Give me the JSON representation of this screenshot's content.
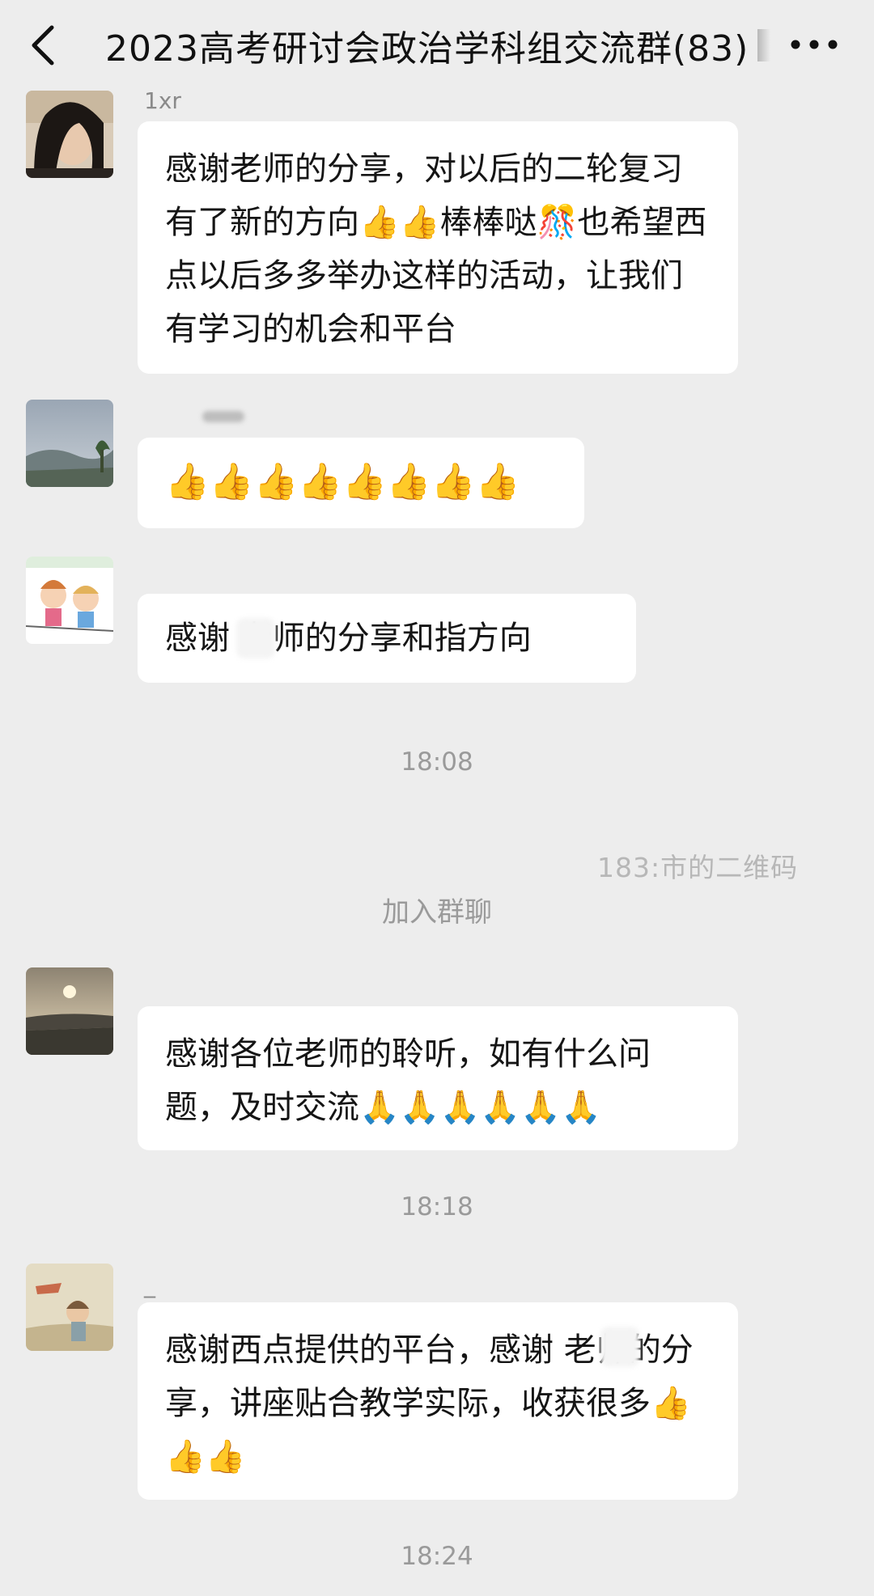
{
  "header": {
    "back_icon": "chevron-left-icon",
    "title": "2023高考研讨会政治学科组交流群(83)",
    "more_icon": "more-dots-icon"
  },
  "messages": [
    {
      "sender": "1xr",
      "text": "感谢老师的分享，对以后的二轮复习有了新的方向👍👍棒棒哒🎊也希望西点以后多多举办这样的活动，让我们有学习的机会和平台"
    },
    {
      "sender": "",
      "text": "👍👍👍👍👍👍👍👍"
    },
    {
      "sender": "",
      "text": "感谢 老师的分享和指方向"
    }
  ],
  "time_1": "18:08",
  "watermark_text": "183:市的二维码",
  "system_notice": "加入群聊",
  "messages_2": [
    {
      "sender": "",
      "text": "感谢各位老师的聆听，如有什么问题，及时交流🙏🙏🙏🙏🙏🙏"
    }
  ],
  "time_2": "18:18",
  "messages_3": [
    {
      "sender": "_",
      "text": "感谢西点提供的平台，感谢 老师的分享，讲座贴合教学实际，收获很多👍👍👍"
    }
  ],
  "time_3": "18:24",
  "colors": {
    "background": "#ededed",
    "bubble": "#ffffff",
    "text": "#151515",
    "meta": "#9a9a9a"
  }
}
